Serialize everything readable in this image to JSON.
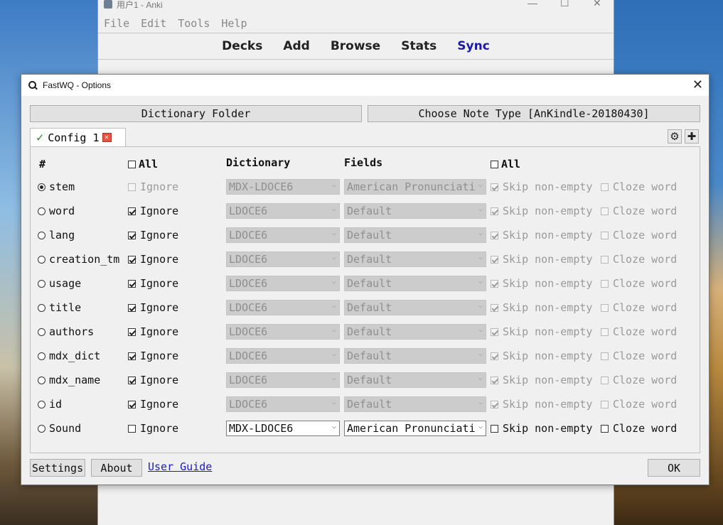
{
  "anki": {
    "title": "用户1 - Anki",
    "menu": [
      "File",
      "Edit",
      "Tools",
      "Help"
    ],
    "toolbar": [
      "Decks",
      "Add",
      "Browse",
      "Stats",
      "Sync"
    ]
  },
  "dialog": {
    "title": "FastWQ - Options",
    "dictionary_folder_label": "Dictionary Folder",
    "choose_note_type_label": "Choose Note Type [AnKindle-20180430]",
    "tab_label": "Config 1",
    "headers": {
      "hash": "#",
      "all_left": "All",
      "dictionary": "Dictionary",
      "fields": "Fields",
      "all_right": "All"
    },
    "rows": [
      {
        "field": "stem",
        "selected": true,
        "ignore_label": "Ignore",
        "ignored": false,
        "ignore_enabled": false,
        "dictionary": "MDX-LDOCE6",
        "field_value": "American Pronunciati",
        "skip_label": "Skip non-empty",
        "skip": true,
        "cloze_label": "Cloze word",
        "cloze": false,
        "enabled": false
      },
      {
        "field": "word",
        "selected": false,
        "ignore_label": "Ignore",
        "ignored": true,
        "ignore_enabled": true,
        "dictionary": "LDOCE6",
        "field_value": "Default",
        "skip_label": "Skip non-empty",
        "skip": true,
        "cloze_label": "Cloze word",
        "cloze": false,
        "enabled": false
      },
      {
        "field": "lang",
        "selected": false,
        "ignore_label": "Ignore",
        "ignored": true,
        "ignore_enabled": true,
        "dictionary": "LDOCE6",
        "field_value": "Default",
        "skip_label": "Skip non-empty",
        "skip": true,
        "cloze_label": "Cloze word",
        "cloze": false,
        "enabled": false
      },
      {
        "field": "creation_tm",
        "selected": false,
        "ignore_label": "Ignore",
        "ignored": true,
        "ignore_enabled": true,
        "dictionary": "LDOCE6",
        "field_value": "Default",
        "skip_label": "Skip non-empty",
        "skip": true,
        "cloze_label": "Cloze word",
        "cloze": false,
        "enabled": false
      },
      {
        "field": "usage",
        "selected": false,
        "ignore_label": "Ignore",
        "ignored": true,
        "ignore_enabled": true,
        "dictionary": "LDOCE6",
        "field_value": "Default",
        "skip_label": "Skip non-empty",
        "skip": true,
        "cloze_label": "Cloze word",
        "cloze": false,
        "enabled": false
      },
      {
        "field": "title",
        "selected": false,
        "ignore_label": "Ignore",
        "ignored": true,
        "ignore_enabled": true,
        "dictionary": "LDOCE6",
        "field_value": "Default",
        "skip_label": "Skip non-empty",
        "skip": true,
        "cloze_label": "Cloze word",
        "cloze": false,
        "enabled": false
      },
      {
        "field": "authors",
        "selected": false,
        "ignore_label": "Ignore",
        "ignored": true,
        "ignore_enabled": true,
        "dictionary": "LDOCE6",
        "field_value": "Default",
        "skip_label": "Skip non-empty",
        "skip": true,
        "cloze_label": "Cloze word",
        "cloze": false,
        "enabled": false
      },
      {
        "field": "mdx_dict",
        "selected": false,
        "ignore_label": "Ignore",
        "ignored": true,
        "ignore_enabled": true,
        "dictionary": "LDOCE6",
        "field_value": "Default",
        "skip_label": "Skip non-empty",
        "skip": true,
        "cloze_label": "Cloze word",
        "cloze": false,
        "enabled": false
      },
      {
        "field": "mdx_name",
        "selected": false,
        "ignore_label": "Ignore",
        "ignored": true,
        "ignore_enabled": true,
        "dictionary": "LDOCE6",
        "field_value": "Default",
        "skip_label": "Skip non-empty",
        "skip": true,
        "cloze_label": "Cloze word",
        "cloze": false,
        "enabled": false
      },
      {
        "field": "id",
        "selected": false,
        "ignore_label": "Ignore",
        "ignored": true,
        "ignore_enabled": true,
        "dictionary": "LDOCE6",
        "field_value": "Default",
        "skip_label": "Skip non-empty",
        "skip": true,
        "cloze_label": "Cloze word",
        "cloze": false,
        "enabled": false
      },
      {
        "field": "Sound",
        "selected": false,
        "ignore_label": "Ignore",
        "ignored": false,
        "ignore_enabled": true,
        "dictionary": "MDX-LDOCE6",
        "field_value": "American Pronunciati",
        "skip_label": "Skip non-empty",
        "skip": false,
        "cloze_label": "Cloze word",
        "cloze": false,
        "enabled": true
      }
    ],
    "footer": {
      "settings_label": "Settings",
      "about_label": "About",
      "user_guide_label": "User Guide",
      "ok_label": "OK"
    }
  }
}
